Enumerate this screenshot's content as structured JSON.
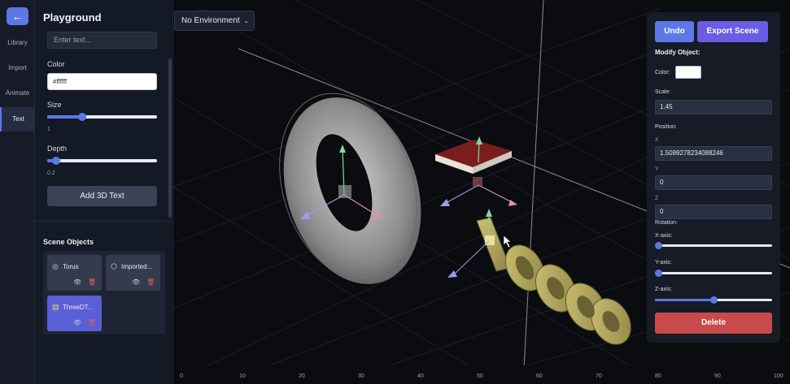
{
  "rail": {
    "back_icon": "arrow-left-icon",
    "items": [
      {
        "label": "Library"
      },
      {
        "label": "Import"
      },
      {
        "label": "Animate"
      },
      {
        "label": "Text"
      }
    ],
    "active_index": 3
  },
  "panel": {
    "title": "Playground",
    "text_placeholder": "Enter text...",
    "color_label": "Color",
    "color_value": "#ffffff",
    "size_label": "Size",
    "size_value": "1",
    "size_fraction": 0.32,
    "depth_label": "Depth",
    "depth_value": "0.2",
    "depth_fraction": 0.08,
    "add_button": "Add 3D Text",
    "scene_objects_title": "Scene Objects",
    "objects": [
      {
        "name": "Torus",
        "icon": "torus-icon"
      },
      {
        "name": "Imported...",
        "icon": "cube-icon"
      },
      {
        "name": "ThreeDT...",
        "icon": "text-file-icon",
        "selected": true
      }
    ]
  },
  "viewport": {
    "environment_select": "No Environment"
  },
  "timeline": {
    "ticks": [
      "0",
      "10",
      "20",
      "30",
      "40",
      "50",
      "60",
      "70",
      "80",
      "90",
      "100"
    ]
  },
  "right_panel": {
    "undo": "Undo",
    "export": "Export Scene",
    "modify_title": "Modify Object:",
    "color_label": "Color:",
    "color_value": "#ffffff",
    "scale_label": "Scale:",
    "scale_value": "1.45",
    "position_label": "Position:",
    "x_label": "X",
    "x_value": "1.5089278234088246",
    "y_label": "Y",
    "y_value": "0",
    "z_label": "Z",
    "z_value": "0",
    "rotation_label": "Rotation:",
    "rot_x_label": "X-axis:",
    "rot_x_fraction": 0.03,
    "rot_y_label": "Y-axis:",
    "rot_y_fraction": 0.03,
    "rot_z_label": "Z-axis:",
    "rot_z_fraction": 0.5,
    "delete": "Delete"
  },
  "colors": {
    "accent": "#5b78e6",
    "export": "#6a5ce3",
    "danger": "#c94a4a",
    "text_object": "#b9ad5e",
    "red_object": "#7a1d1d"
  }
}
